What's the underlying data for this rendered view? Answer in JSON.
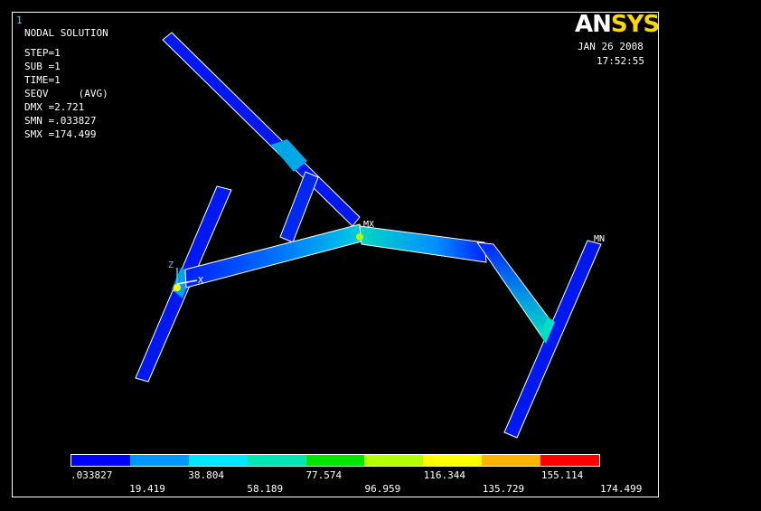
{
  "window_number": "1",
  "logo": {
    "an": "AN",
    "sys": "SYS"
  },
  "header": {
    "title": "NODAL SOLUTION",
    "step": "STEP=1",
    "sub": "SUB =1",
    "time": "TIME=1",
    "seqv": "SEQV     (AVG)",
    "dmx": "DMX =2.721",
    "smn": "SMN =.033827",
    "smx": "SMX =174.499"
  },
  "date": "JAN 26 2008",
  "clock": "17:52:55",
  "markers": {
    "mx": "MX",
    "mn": "MN",
    "axis_z": "Z",
    "axis_x": "X"
  },
  "legend": {
    "colors": [
      "#0000ff",
      "#0096ff",
      "#00e6ff",
      "#00e6b4",
      "#00e600",
      "#b4ff00",
      "#ffff00",
      "#ffb400",
      "#ff0000"
    ],
    "top_labels": [
      ".033827",
      "38.804",
      "77.574",
      "116.344",
      "155.114"
    ],
    "bottom_labels": [
      "19.419",
      "58.189",
      "96.959",
      "135.729",
      "174.499"
    ]
  }
}
